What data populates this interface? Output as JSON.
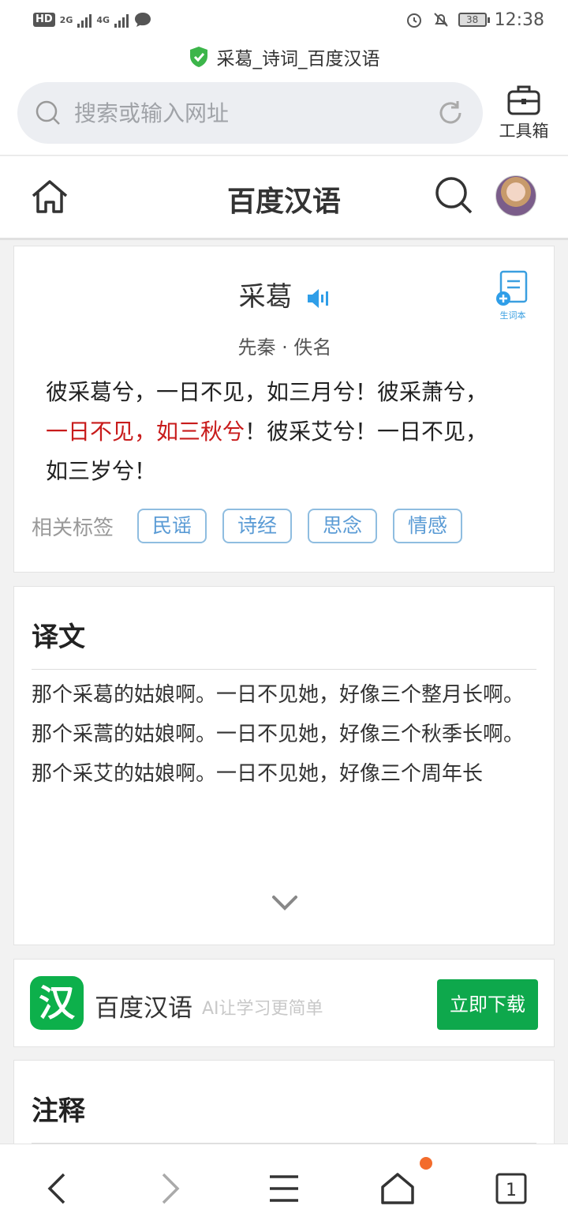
{
  "status_bar": {
    "hd": "HD",
    "hd_sub": "2",
    "net1": "2G",
    "net2": "4G",
    "battery": "38",
    "time": "12:38"
  },
  "page_title": "采葛_诗词_百度汉语",
  "search": {
    "placeholder": "搜索或输入网址"
  },
  "toolbox_label": "工具箱",
  "site": {
    "title": "百度汉语"
  },
  "poem": {
    "title": "采葛",
    "vocab_label": "生词本",
    "author": "先秦 · 佚名",
    "line1": "彼采葛兮，一日不见，如三月兮！彼采萧兮，",
    "line2_highlight": "一日不见，如三秋兮",
    "line2_rest": "！彼采艾兮！一日不见，",
    "line3": "如三岁兮！",
    "tags_label": "相关标签",
    "tags": [
      "民谣",
      "诗经",
      "思念",
      "情感"
    ]
  },
  "translation": {
    "title": "译文",
    "lines": [
      "那个采葛的姑娘啊。一日不见她，好像三个整月长啊。",
      "那个采蒿的姑娘啊。一日不见她，好像三个秋季长啊。",
      "那个采艾的姑娘啊。一日不见她，好像三个周年长"
    ]
  },
  "ad": {
    "icon_char": "汉",
    "app_name": "百度汉语",
    "slogan": "AI让学习更简单",
    "button": "立即下载"
  },
  "notes": {
    "title": "注释"
  },
  "bottom_nav": {
    "tab_count": "1"
  },
  "colors": {
    "accent_green": "#0ea84c",
    "highlight_red": "#c81b1b",
    "tag_blue": "#5a9bd5",
    "notify_dot": "#f36c2c"
  }
}
